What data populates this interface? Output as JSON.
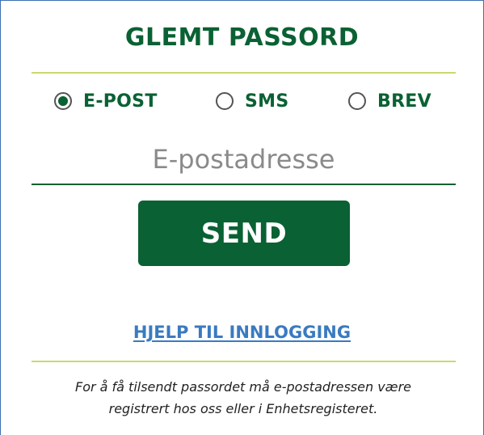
{
  "form": {
    "title": "GLEMT PASSORD",
    "options": [
      {
        "label": "E-POST",
        "checked": true
      },
      {
        "label": "SMS",
        "checked": false
      },
      {
        "label": "BREV",
        "checked": false
      }
    ],
    "email_placeholder": "E-postadresse",
    "email_value": "",
    "send_label": "SEND",
    "help_link": "HJELP TIL INNLOGGING",
    "note_line1": "For å få tilsendt passordet må e-postadressen være",
    "note_line2": "registrert hos oss eller i Enhetsregisteret."
  },
  "colors": {
    "primary_green": "#0a6133",
    "divider_lime": "#cad96e",
    "link_blue": "#3a7ac1",
    "frame_blue": "#3c6fb4"
  }
}
